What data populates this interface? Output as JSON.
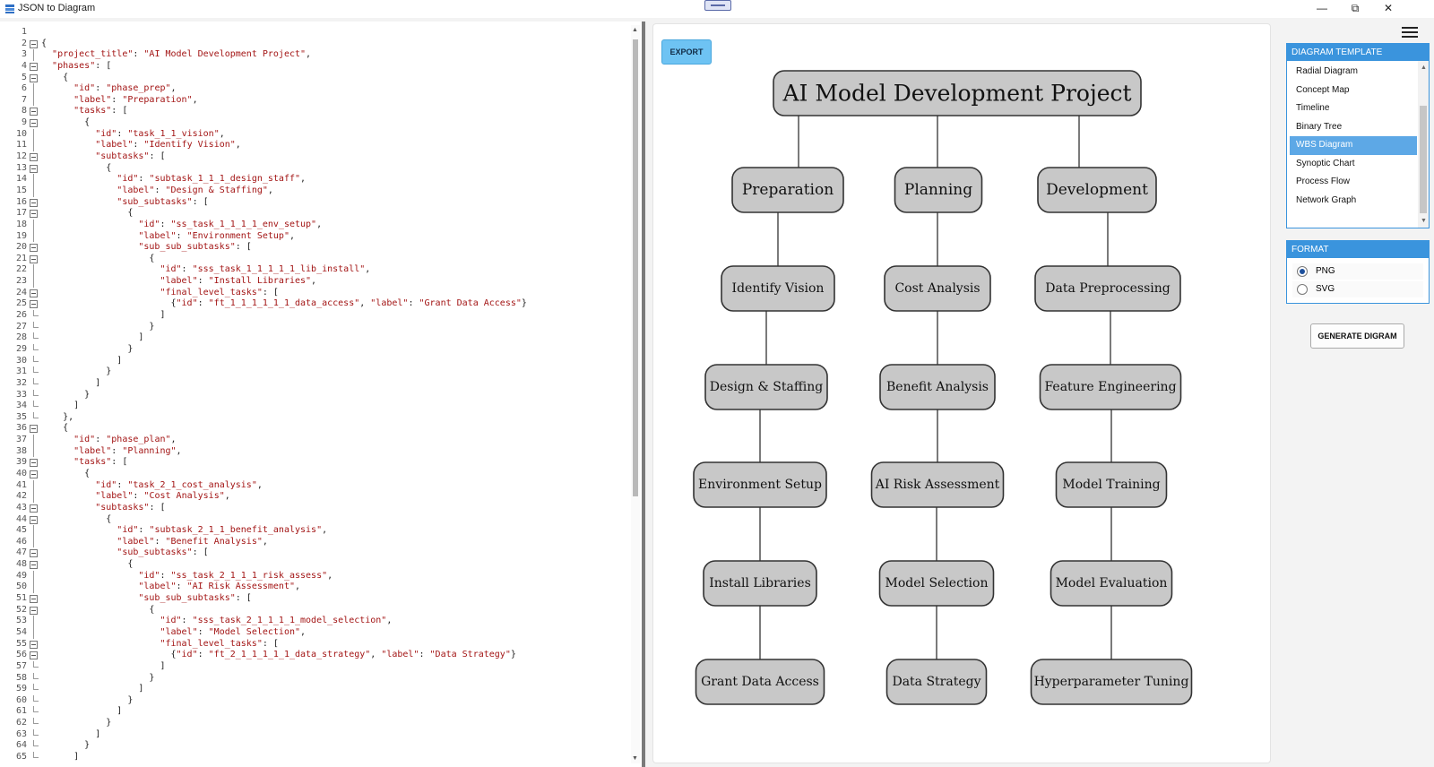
{
  "window": {
    "title": "JSON to Diagram",
    "minimize": "—",
    "restore": "⧉",
    "close": "✕"
  },
  "editor": {
    "lines": [
      "",
      "{",
      "  \"project_title\": \"AI Model Development Project\",",
      "  \"phases\": [",
      "    {",
      "      \"id\": \"phase_prep\",",
      "      \"label\": \"Preparation\",",
      "      \"tasks\": [",
      "        {",
      "          \"id\": \"task_1_1_vision\",",
      "          \"label\": \"Identify Vision\",",
      "          \"subtasks\": [",
      "            {",
      "              \"id\": \"subtask_1_1_1_design_staff\",",
      "              \"label\": \"Design & Staffing\",",
      "              \"sub_subtasks\": [",
      "                {",
      "                  \"id\": \"ss_task_1_1_1_1_env_setup\",",
      "                  \"label\": \"Environment Setup\",",
      "                  \"sub_sub_subtasks\": [",
      "                    {",
      "                      \"id\": \"sss_task_1_1_1_1_1_lib_install\",",
      "                      \"label\": \"Install Libraries\",",
      "                      \"final_level_tasks\": [",
      "                        {\"id\": \"ft_1_1_1_1_1_1_data_access\", \"label\": \"Grant Data Access\"}",
      "                      ]",
      "                    }",
      "                  ]",
      "                }",
      "              ]",
      "            }",
      "          ]",
      "        }",
      "      ]",
      "    },",
      "    {",
      "      \"id\": \"phase_plan\",",
      "      \"label\": \"Planning\",",
      "      \"tasks\": [",
      "        {",
      "          \"id\": \"task_2_1_cost_analysis\",",
      "          \"label\": \"Cost Analysis\",",
      "          \"subtasks\": [",
      "            {",
      "              \"id\": \"subtask_2_1_1_benefit_analysis\",",
      "              \"label\": \"Benefit Analysis\",",
      "              \"sub_subtasks\": [",
      "                {",
      "                  \"id\": \"ss_task_2_1_1_1_risk_assess\",",
      "                  \"label\": \"AI Risk Assessment\",",
      "                  \"sub_sub_subtasks\": [",
      "                    {",
      "                      \"id\": \"sss_task_2_1_1_1_1_model_selection\",",
      "                      \"label\": \"Model Selection\",",
      "                      \"final_level_tasks\": [",
      "                        {\"id\": \"ft_2_1_1_1_1_1_data_strategy\", \"label\": \"Data Strategy\"}",
      "                      ]",
      "                    }",
      "                  ]",
      "                }",
      "              ]",
      "            }",
      "          ]",
      "        }",
      "      ]"
    ],
    "fold_open_lines": [
      2,
      4,
      5,
      8,
      9,
      12,
      13,
      16,
      17,
      20,
      21,
      24,
      25,
      36,
      39,
      40,
      43,
      44,
      47,
      48,
      51,
      52,
      55,
      56
    ]
  },
  "export_label": "EXPORT",
  "diagram": {
    "root": "AI Model Development Project",
    "columns": [
      [
        "Preparation",
        "Identify Vision",
        "Design & Staffing",
        "Environment Setup",
        "Install Libraries",
        "Grant Data Access"
      ],
      [
        "Planning",
        "Cost Analysis",
        "Benefit Analysis",
        "AI Risk Assessment",
        "Model Selection",
        "Data Strategy"
      ],
      [
        "Development",
        "Data Preprocessing",
        "Feature Engineering",
        "Model Training",
        "Model Evaluation",
        "Hyperparameter Tuning"
      ]
    ]
  },
  "right_panel": {
    "template_header": "DIAGRAM TEMPLATE",
    "templates": [
      "Radial Diagram",
      "Concept Map",
      "Timeline",
      "Binary Tree",
      "WBS Diagram",
      "Synoptic Chart",
      "Process Flow",
      "Network Graph"
    ],
    "selected_template": "WBS Diagram",
    "format_header": "FORMAT",
    "formats": [
      "PNG",
      "SVG"
    ],
    "selected_format": "PNG",
    "generate_label": "GENERATE DIGRAM"
  },
  "colors": {
    "accent": "#3a94dd",
    "node_fill": "#c8c8c8",
    "node_stroke": "#333333",
    "export_button": "#6ec3f3"
  }
}
